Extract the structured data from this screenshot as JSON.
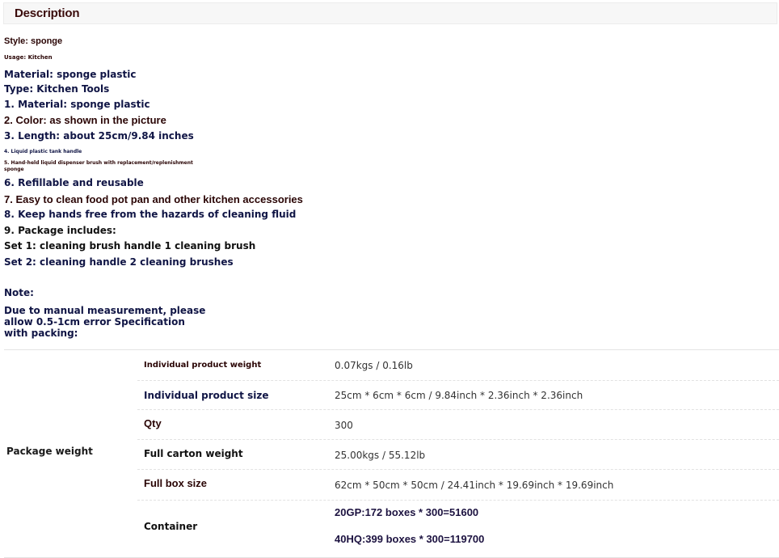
{
  "header": {
    "title": "Description"
  },
  "lines": [
    "Style: sponge",
    "Usage: Kitchen",
    "Material: sponge plastic",
    "Type: Kitchen Tools",
    " 1. Material: sponge plastic",
    "2. Color: as shown in the picture",
    "3. Length: about 25cm/9.84 inches",
    "4. Liquid plastic tank handle",
    "5. Hand-held liquid dispenser brush with replacement/replenishment",
    "sponge",
    " 6. Refillable and reusable",
    "7. Easy to clean food pot pan and other kitchen accessories",
    "8. Keep hands free from the hazards of cleaning fluid",
    "9. Package includes:",
    "Set 1: cleaning brush handle 1 cleaning brush",
    "Set 2: cleaning handle 2 cleaning brushes"
  ],
  "note": {
    "label": "Note:",
    "text": "Due to manual measurement, please\nallow 0.5-1cm error Specification\nwith packing:"
  },
  "spec": {
    "group_label": "Package weight",
    "rows": [
      {
        "key": "Individual product weight",
        "value": "0.07kgs / 0.16lb"
      },
      {
        "key": "Individual product size",
        "value": "25cm * 6cm * 6cm / 9.84inch * 2.36inch * 2.36inch"
      },
      {
        "key": "Qty",
        "value": "300"
      },
      {
        "key": "Full carton weight",
        "value": "25.00kgs / 55.12lb"
      },
      {
        "key": "Full box size",
        "value": "62cm * 50cm * 50cm / 24.41inch * 19.69inch * 19.69inch"
      },
      {
        "key": "Container",
        "values": [
          "20GP:172 boxes * 300=51600",
          "40HQ:399 boxes * 300=119700"
        ]
      }
    ]
  }
}
